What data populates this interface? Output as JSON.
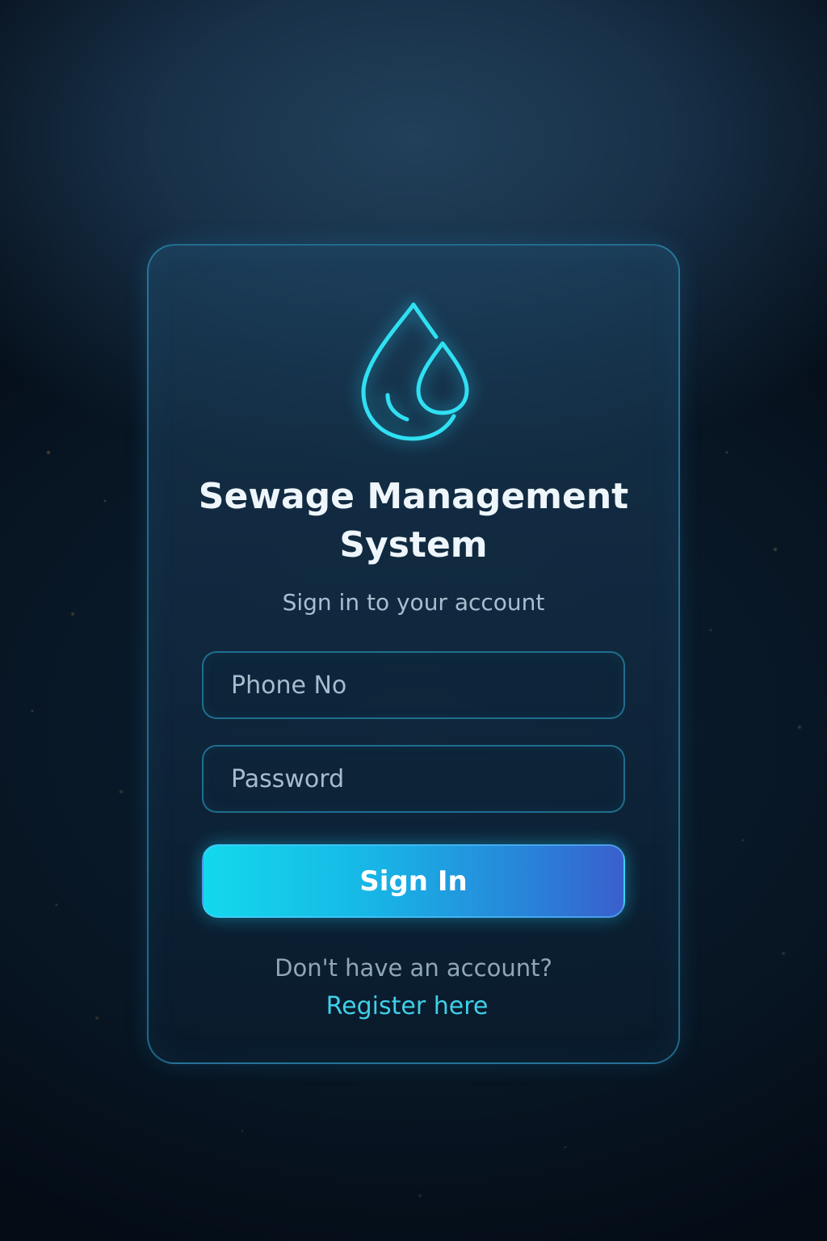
{
  "app": {
    "title_line1": "Sewage Management",
    "title_line2": "System",
    "subtitle": "Sign in to your account"
  },
  "form": {
    "phone_placeholder": "Phone No",
    "phone_value": "",
    "password_placeholder": "Password",
    "password_value": "",
    "submit_label": "Sign In"
  },
  "footer": {
    "prompt": "Don't have an account?",
    "register_label": "Register here"
  },
  "icons": {
    "logo": "water-drops-icon"
  },
  "colors": {
    "accent": "#2fd6ee",
    "button_start": "#13d9ec",
    "button_end": "#3a5fcc",
    "link": "#3fd0e8",
    "card_border": "#32aad7"
  }
}
